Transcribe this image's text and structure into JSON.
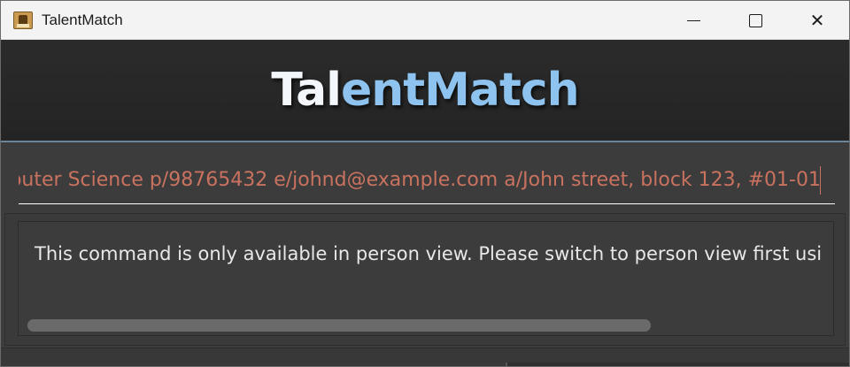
{
  "window": {
    "title": "TalentMatch",
    "app_icon": "address-book-icon",
    "controls": {
      "minimize_icon": "minimize-icon",
      "maximize_icon": "maximize-icon",
      "close_icon": "close-icon",
      "close_glyph": "✕"
    }
  },
  "header": {
    "brand_part1": "Tal",
    "brand_part2": "entMatch",
    "colors": {
      "light": "#f3f7fb",
      "accent": "#8fc3ef"
    }
  },
  "command_box": {
    "value": "outer Science p/98765432 e/johnd@example.com a/John street, block 123, #01-01",
    "text_color": "#c9725f"
  },
  "result_display": {
    "message": "This command is only available in person view. Please switch to person view first usi"
  }
}
